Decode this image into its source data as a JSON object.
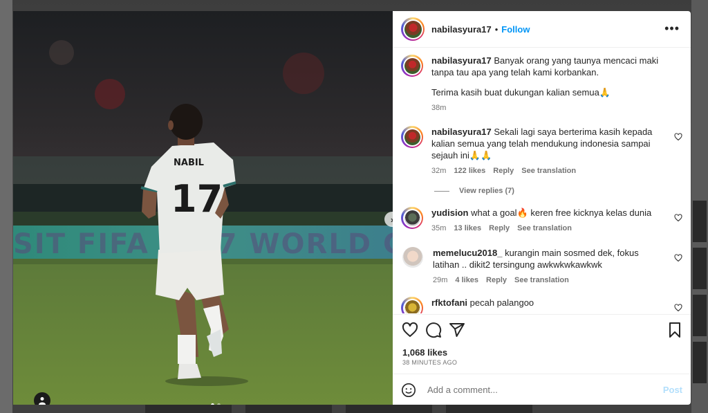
{
  "post": {
    "author": "nabilasyura17",
    "follow_label": "Follow",
    "bullet": "•",
    "more_label": "•••",
    "caption": {
      "username": "nabilasyura17",
      "line1": "Banyak orang yang taunya mencaci maki tanpa tau apa yang telah kami korbankan.",
      "line2": "Terima kasih buat dukungan kalian semua🙏",
      "time": "38m"
    },
    "comments": [
      {
        "username": "nabilasyura17",
        "text": "Sekali lagi saya berterima kasih kepada kalian semua yang telah mendukung indonesia sampai sejauh ini🙏🙏",
        "time": "32m",
        "likes": "122 likes",
        "reply": "Reply",
        "translate": "See translation",
        "view_replies": "View replies (7)"
      },
      {
        "username": "yudision",
        "text": "what a goal🔥 keren free kicknya kelas dunia",
        "time": "35m",
        "likes": "13 likes",
        "reply": "Reply",
        "translate": "See translation"
      },
      {
        "username": "memelucu2018_",
        "text": "kurangin main sosmed dek, fokus latihan .. dikit2 tersingung awkwkwkawkwk",
        "time": "29m",
        "likes": "4 likes",
        "reply": "Reply",
        "translate": "See translation"
      },
      {
        "username": "rfktofani",
        "text": "pecah palangoo"
      }
    ],
    "likes_count": "1,068 likes",
    "posted_ago": "38 MINUTES AGO",
    "comment_placeholder": "Add a comment...",
    "post_label": "Post",
    "carousel": {
      "total": 2,
      "current": 1
    }
  },
  "photo": {
    "jersey_name": "NABIL",
    "jersey_number": "17"
  },
  "colors": {
    "follow": "#0095f6",
    "post_disabled": "#b2dffc",
    "muted": "#737373"
  }
}
